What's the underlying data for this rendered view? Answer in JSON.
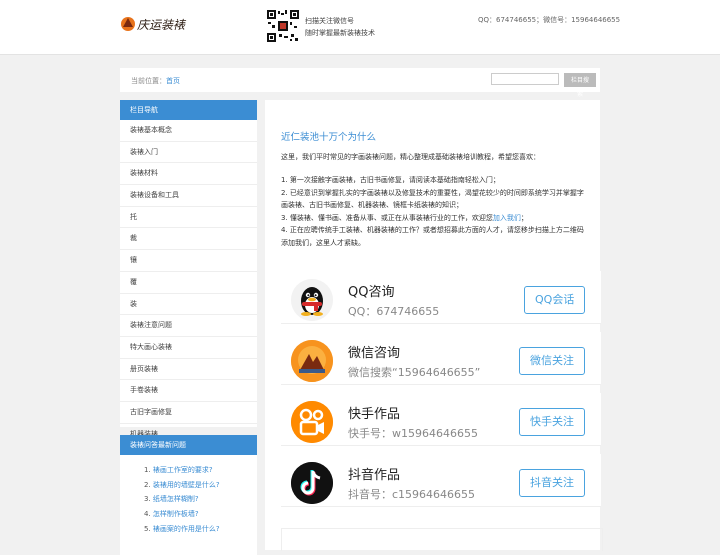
{
  "header": {
    "logo_text": "庆运装裱",
    "qr_line1": "扫描关注微信号",
    "qr_line2": "随时掌握最新装裱技术",
    "contact": "QQ：674746655；微信号：15964646655"
  },
  "breadcrumb": {
    "label": "当前位置：",
    "home": "首页",
    "search_button": "栏目搜索",
    "search_placeholder": ""
  },
  "sidebar": {
    "nav_title": "栏目导航",
    "nav_items": [
      "装裱基本概念",
      "装裱入门",
      "装裱材料",
      "装裱设备和工具",
      "托",
      "裁",
      "镶",
      "覆",
      "装",
      "装裱注意问题",
      "特大画心装裱",
      "册页装裱",
      "手卷装裱",
      "古旧字画修复",
      "机器装裱"
    ],
    "qa_title": "装裱问答最新问题",
    "qa_items": [
      {
        "num": "1.",
        "text": "裱画工作室的要求?"
      },
      {
        "num": "2.",
        "text": "装裱用的墙壁是什么?"
      },
      {
        "num": "3.",
        "text": "纸墙怎样糊制?"
      },
      {
        "num": "4.",
        "text": "怎样制作板墙?"
      },
      {
        "num": "5.",
        "text": "裱画案的作用是什么?"
      }
    ]
  },
  "main": {
    "title": "近仁装池十万个为什么",
    "intro": "这里，我们平时常见的字画装裱问题，精心整理成基础装裱培训教程，希望您喜欢：",
    "tips": [
      {
        "text": "1. 第一次接触字画装裱，古旧书画修复，请阅读本基础指南轻松入门；"
      },
      {
        "text": "2. 已经意识到掌握扎实的字画装裱以及修复技术的重要性，渴望花较少的时间即系统学习并掌握字画装裱、古旧书画修复、机器装裱、镜框卡纸装裱的知识；"
      },
      {
        "text": "3. 懂装裱、懂书画、准备从事、或正在从事装裱行业的工作，欢迎您",
        "link": "加入我们",
        "after": "；"
      },
      {
        "text": "4. 正在应聘传统手工装裱、机器装裱的工作？或者想招募此方面的人才，请您移步扫描上方二维码添加我们，这里人才紧缺。"
      }
    ],
    "cards": [
      {
        "title": "QQ咨询",
        "sub": "QQ：674746655",
        "button": "QQ会话",
        "color": "#1a1a1a"
      },
      {
        "title": "微信咨询",
        "sub": "微信搜索“15964646655”",
        "button": "微信关注",
        "color": "#f7931e"
      },
      {
        "title": "快手作品",
        "sub": "快手号：w15964646655",
        "button": "快手关注",
        "color": "#ff8a00"
      },
      {
        "title": "抖音作品",
        "sub": "抖音号：c15964646655",
        "button": "抖音关注",
        "color": "#111111"
      }
    ]
  }
}
